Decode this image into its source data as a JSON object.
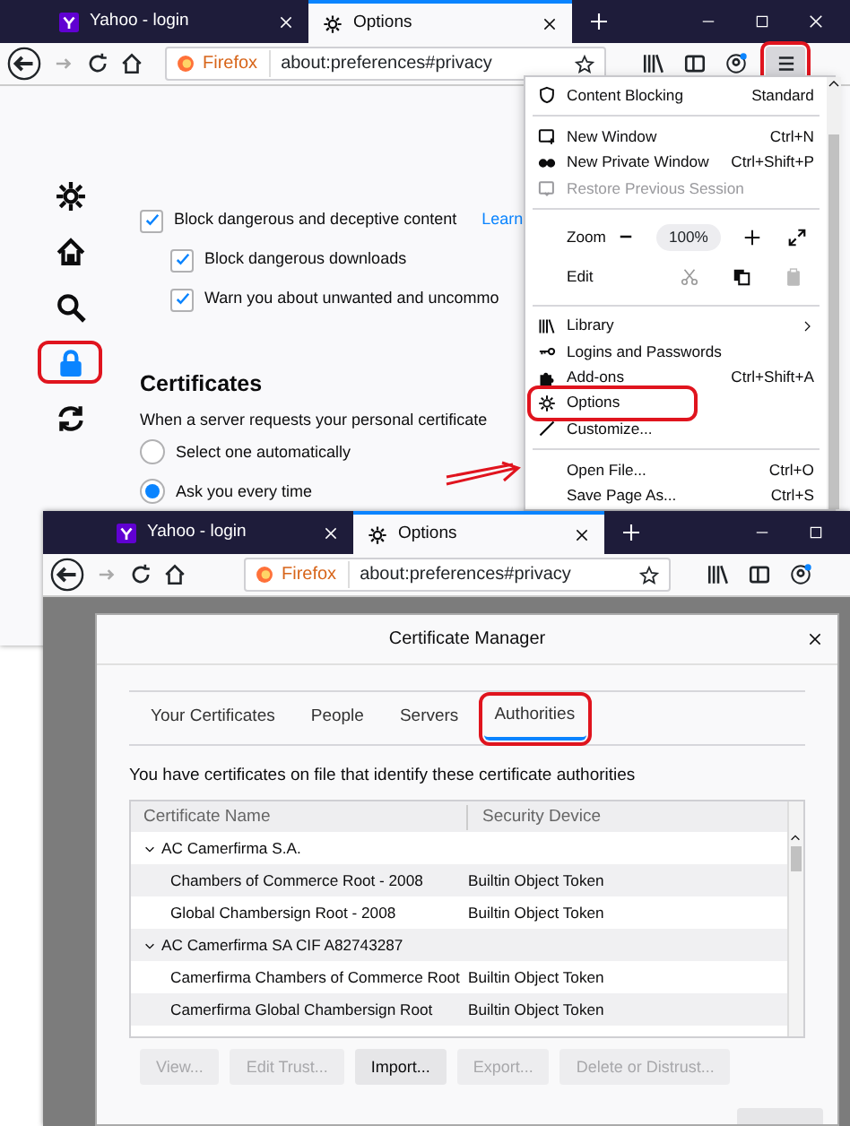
{
  "back_window": {
    "tabs": [
      {
        "label": "Yahoo - login",
        "selected": false
      },
      {
        "label": "Options",
        "selected": true
      }
    ],
    "address": {
      "identity": "Firefox",
      "url": "about:preferences#privacy"
    },
    "menu_button": {
      "highlighted": true
    },
    "sidebar": [
      {
        "selected": false,
        "highlighted": false
      },
      {
        "selected": false,
        "highlighted": false
      },
      {
        "selected": false,
        "highlighted": false
      },
      {
        "selected": true,
        "highlighted": true
      },
      {
        "selected": false,
        "highlighted": false
      }
    ],
    "protection": {
      "checkboxes": [
        {
          "label": "Block dangerous and deceptive content",
          "checked": true,
          "link": "Learn",
          "children": [
            {
              "label": "Block dangerous downloads",
              "checked": true
            },
            {
              "label": "Warn you about unwanted and uncommo",
              "checked": true
            }
          ]
        }
      ]
    },
    "certificates": {
      "heading": "Certificates",
      "description": "When a server requests your personal certificate",
      "options": [
        {
          "label": "Select one automatically",
          "selected": false
        },
        {
          "label": "Ask you every time",
          "selected": true
        }
      ]
    },
    "menu": {
      "items": [
        {
          "kind": "item",
          "label": "Content Blocking",
          "shortcut": "Standard",
          "disabled": false,
          "highlighted": false
        },
        {
          "kind": "separator"
        },
        {
          "kind": "item",
          "label": "New Window",
          "shortcut": "Ctrl+N",
          "disabled": false,
          "highlighted": false
        },
        {
          "kind": "item",
          "label": "New Private Window",
          "shortcut": "Ctrl+Shift+P",
          "disabled": false,
          "highlighted": false
        },
        {
          "kind": "item",
          "label": "Restore Previous Session",
          "disabled": true,
          "highlighted": false
        },
        {
          "kind": "separator"
        },
        {
          "kind": "zoom",
          "label": "Zoom",
          "value": "100%"
        },
        {
          "kind": "edit",
          "label": "Edit"
        },
        {
          "kind": "separator"
        },
        {
          "kind": "item",
          "label": "Library",
          "submenu": true,
          "disabled": false,
          "highlighted": false
        },
        {
          "kind": "item",
          "label": "Logins and Passwords",
          "disabled": false,
          "highlighted": false
        },
        {
          "kind": "item",
          "label": "Add-ons",
          "shortcut": "Ctrl+Shift+A",
          "disabled": false,
          "highlighted": false
        },
        {
          "kind": "item",
          "label": "Options",
          "disabled": false,
          "highlighted": true
        },
        {
          "kind": "item",
          "label": "Customize...",
          "disabled": false,
          "highlighted": false
        },
        {
          "kind": "separator"
        },
        {
          "kind": "item",
          "label": "Open File...",
          "shortcut": "Ctrl+O",
          "disabled": false,
          "highlighted": false
        },
        {
          "kind": "item",
          "label": "Save Page As...",
          "shortcut": "Ctrl+S",
          "disabled": false,
          "highlighted": false
        }
      ]
    }
  },
  "front_window": {
    "tabs": [
      {
        "label": "Yahoo - login",
        "selected": false
      },
      {
        "label": "Options",
        "selected": true
      }
    ],
    "address": {
      "identity": "Firefox",
      "url": "about:preferences#privacy"
    },
    "dialog": {
      "title": "Certificate Manager",
      "tabs": [
        {
          "label": "Your Certificates",
          "selected": false,
          "highlighted": false
        },
        {
          "label": "People",
          "selected": false,
          "highlighted": false
        },
        {
          "label": "Servers",
          "selected": false,
          "highlighted": false
        },
        {
          "label": "Authorities",
          "selected": true,
          "highlighted": true
        }
      ],
      "description": "You have certificates on file that identify these certificate authorities",
      "table": {
        "columns": [
          "Certificate Name",
          "Security Device"
        ],
        "rows": [
          {
            "name": "AC Camerfirma S.A.",
            "expanded": true,
            "children": [
              {
                "name": "Chambers of Commerce Root - 2008",
                "device": "Builtin Object Token"
              },
              {
                "name": "Global Chambersign Root - 2008",
                "device": "Builtin Object Token"
              }
            ]
          },
          {
            "name": "AC Camerfirma SA CIF A82743287",
            "expanded": true,
            "children": [
              {
                "name": "Camerfirma Chambers of Commerce Root",
                "device": "Builtin Object Token"
              },
              {
                "name": "Camerfirma Global Chambersign Root",
                "device": "Builtin Object Token"
              }
            ]
          }
        ]
      },
      "buttons": [
        {
          "label": "View...",
          "disabled": true
        },
        {
          "label": "Edit Trust...",
          "disabled": true
        },
        {
          "label": "Import...",
          "disabled": false
        },
        {
          "label": "Export...",
          "disabled": true
        },
        {
          "label": "Delete or Distrust...",
          "disabled": true
        }
      ]
    }
  }
}
